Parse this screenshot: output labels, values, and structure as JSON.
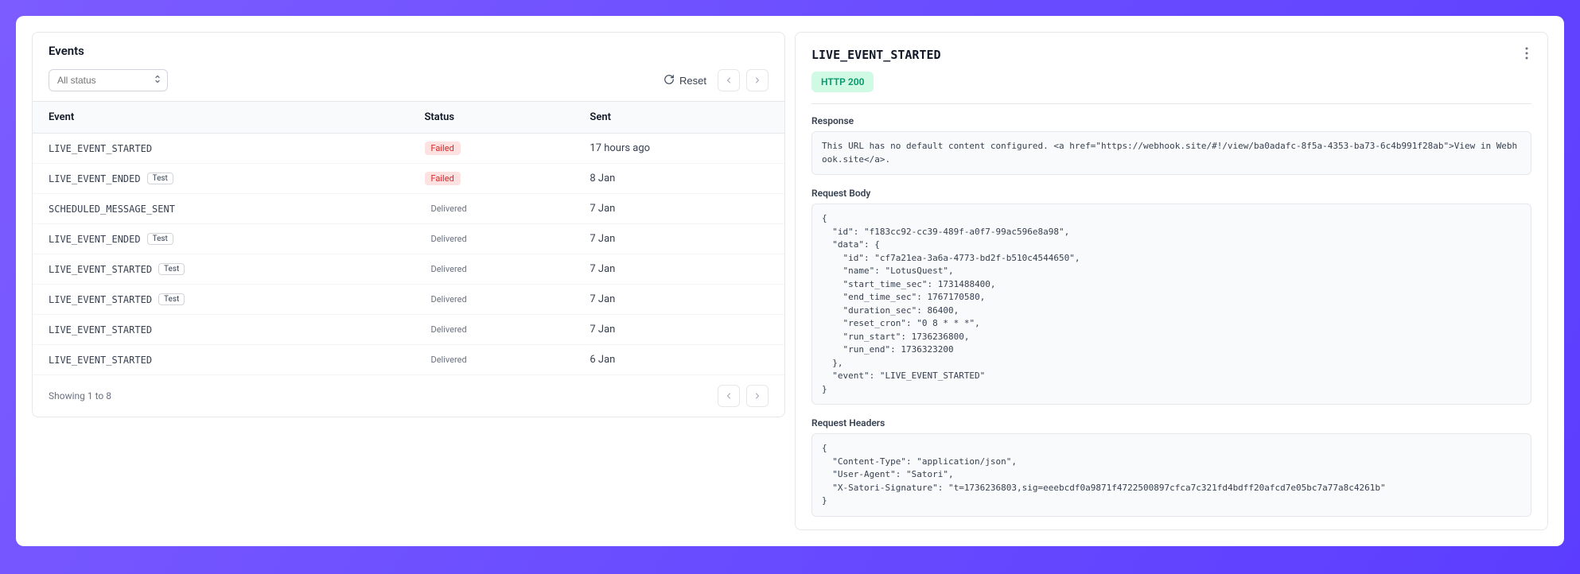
{
  "left": {
    "title": "Events",
    "filter_placeholder": "All status",
    "reset_label": "Reset",
    "columns": {
      "event": "Event",
      "status": "Status",
      "sent": "Sent"
    },
    "rows": [
      {
        "event": "LIVE_EVENT_STARTED",
        "test": false,
        "status": "Failed",
        "status_class": "failed",
        "sent": "17 hours ago"
      },
      {
        "event": "LIVE_EVENT_ENDED",
        "test": true,
        "status": "Failed",
        "status_class": "failed",
        "sent": "8 Jan"
      },
      {
        "event": "SCHEDULED_MESSAGE_SENT",
        "test": false,
        "status": "Delivered",
        "status_class": "delivered",
        "sent": "7 Jan"
      },
      {
        "event": "LIVE_EVENT_ENDED",
        "test": true,
        "status": "Delivered",
        "status_class": "delivered",
        "sent": "7 Jan"
      },
      {
        "event": "LIVE_EVENT_STARTED",
        "test": true,
        "status": "Delivered",
        "status_class": "delivered",
        "sent": "7 Jan"
      },
      {
        "event": "LIVE_EVENT_STARTED",
        "test": true,
        "status": "Delivered",
        "status_class": "delivered",
        "sent": "7 Jan"
      },
      {
        "event": "LIVE_EVENT_STARTED",
        "test": false,
        "status": "Delivered",
        "status_class": "delivered",
        "sent": "7 Jan"
      },
      {
        "event": "LIVE_EVENT_STARTED",
        "test": false,
        "status": "Delivered",
        "status_class": "delivered",
        "sent": "6 Jan"
      }
    ],
    "test_badge_label": "Test",
    "showing": "Showing 1 to 8"
  },
  "right": {
    "title": "LIVE_EVENT_STARTED",
    "http_status": "HTTP 200",
    "response_label": "Response",
    "response_body": "This URL has no default content configured. <a href=\"https://webhook.site/#!/view/ba0adafc-8f5a-4353-ba73-6c4b991f28ab\">View in Webhook.site</a>.",
    "body_label": "Request Body",
    "body_content": "{\n  \"id\": \"f183cc92-cc39-489f-a0f7-99ac596e8a98\",\n  \"data\": {\n    \"id\": \"cf7a21ea-3a6a-4773-bd2f-b510c4544650\",\n    \"name\": \"LotusQuest\",\n    \"start_time_sec\": 1731488400,\n    \"end_time_sec\": 1767170580,\n    \"duration_sec\": 86400,\n    \"reset_cron\": \"0 8 * * *\",\n    \"run_start\": 1736236800,\n    \"run_end\": 1736323200\n  },\n  \"event\": \"LIVE_EVENT_STARTED\"\n}",
    "headers_label": "Request Headers",
    "headers_content": "{\n  \"Content-Type\": \"application/json\",\n  \"User-Agent\": \"Satori\",\n  \"X-Satori-Signature\": \"t=1736236803,sig=eeebcdf0a9871f4722500897cfca7c321fd4bdff20afcd7e05bc7a77a8c4261b\"\n}"
  }
}
